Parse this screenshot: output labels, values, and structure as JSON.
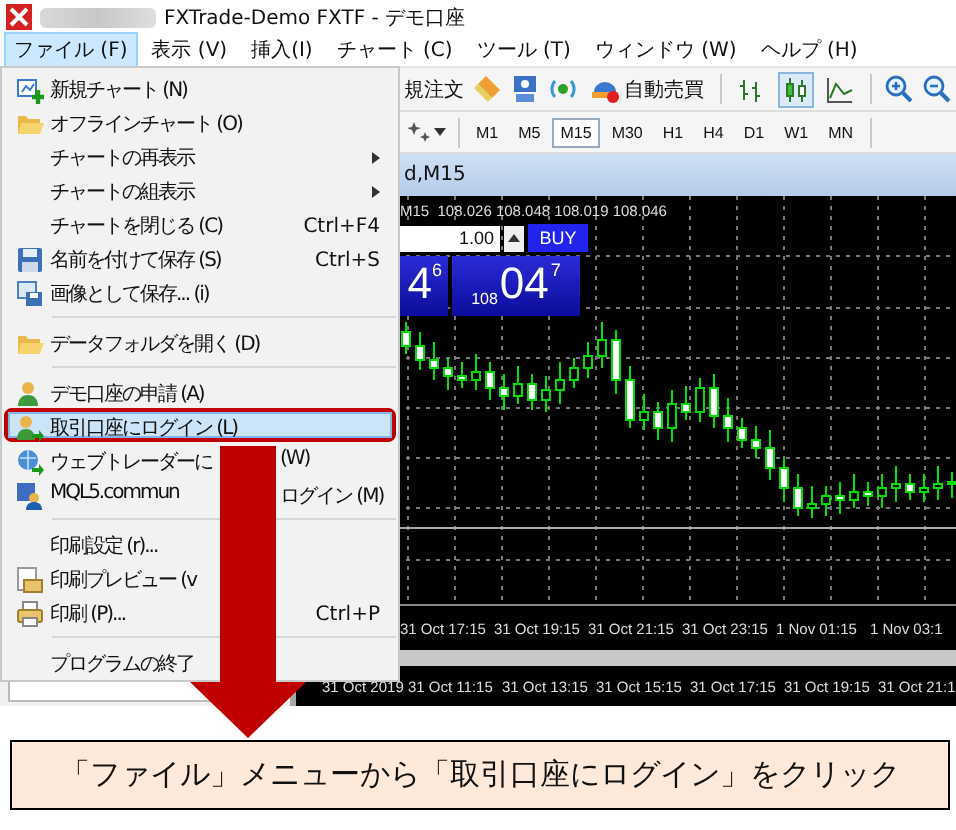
{
  "window": {
    "title": "FXTrade-Demo FXTF - デモ口座"
  },
  "menu_bar": [
    {
      "label": "ファイル (F)",
      "selected": true
    },
    {
      "label": "表示 (V)",
      "selected": false
    },
    {
      "label": "挿入(I)",
      "selected": false
    },
    {
      "label": "チャート (C)",
      "selected": false
    },
    {
      "label": "ツール (T)",
      "selected": false
    },
    {
      "label": "ウィンドウ (W)",
      "selected": false
    },
    {
      "label": "ヘルプ (H)",
      "selected": false
    }
  ],
  "toolbar": {
    "order_label": "規注文",
    "auto_trade": "自動売買",
    "chart_types": [
      {
        "kind": "bar",
        "selected": false
      },
      {
        "kind": "candle",
        "selected": true
      },
      {
        "kind": "line",
        "selected": false
      }
    ]
  },
  "timeframes": [
    {
      "label": "M1",
      "selected": false
    },
    {
      "label": "M5",
      "selected": false
    },
    {
      "label": "M15",
      "selected": true
    },
    {
      "label": "M30",
      "selected": false
    },
    {
      "label": "H1",
      "selected": false
    },
    {
      "label": "H4",
      "selected": false
    },
    {
      "label": "D1",
      "selected": false
    },
    {
      "label": "W1",
      "selected": false
    },
    {
      "label": "MN",
      "selected": false
    }
  ],
  "chart_window": {
    "title": "d,M15",
    "quote": "M15  108.026 108.048 108.019 108.046",
    "lot": "1.00",
    "buy_button": "BUY",
    "sell_price": {
      "main": "4",
      "pip": "6"
    },
    "buy_price": {
      "prefix": "108",
      "main": "04",
      "pip": "7"
    },
    "time_axis": [
      "31 Oct 17:15",
      "31 Oct 19:15",
      "31 Oct 21:15",
      "31 Oct 23:15",
      "1 Nov 01:15",
      "1 Nov 03:1"
    ],
    "lower_axis": [
      "31 Oct 2019",
      "31 Oct 11:15",
      "31 Oct 13:15",
      "31 Oct 15:15",
      "31 Oct 17:15",
      "31 Oct 19:15",
      "31 Oct 21:1"
    ]
  },
  "file_menu": [
    {
      "kind": "item",
      "label": "新規チャート (N)",
      "selected": false
    },
    {
      "kind": "item",
      "label": "オフラインチャート (O)",
      "selected": false
    },
    {
      "kind": "submenu",
      "label": "チャートの再表示",
      "selected": false
    },
    {
      "kind": "submenu",
      "label": "チャートの組表示",
      "selected": false
    },
    {
      "kind": "item",
      "label": "チャートを閉じる (C)",
      "shortcut": "Ctrl+F4",
      "selected": false
    },
    {
      "kind": "item",
      "label": "名前を付けて保存 (S)",
      "shortcut": "Ctrl+S",
      "selected": false
    },
    {
      "kind": "item",
      "label": "画像として保存... (i)",
      "selected": false
    },
    {
      "kind": "separator"
    },
    {
      "kind": "item",
      "label": "データフォルダを開く (D)",
      "selected": false
    },
    {
      "kind": "separator"
    },
    {
      "kind": "item",
      "label": "デモ口座の申請 (A)",
      "selected": false
    },
    {
      "kind": "item",
      "label": "取引口座にログイン (L)",
      "selected": true
    },
    {
      "kind": "item",
      "label": "ウェブトレーダーに",
      "tail": "(W)",
      "selected": false
    },
    {
      "kind": "item",
      "label": "MQL5.commun",
      "tail": "ログイン (M)",
      "selected": false
    },
    {
      "kind": "separator"
    },
    {
      "kind": "item",
      "label": "印刷設定 (r)...",
      "selected": false
    },
    {
      "kind": "item",
      "label": "印刷プレビュー (v",
      "selected": false
    },
    {
      "kind": "item",
      "label": "印刷 (P)...",
      "shortcut": "Ctrl+P",
      "selected": false
    },
    {
      "kind": "separator"
    },
    {
      "kind": "item",
      "label": "プログラムの終了",
      "selected": false
    }
  ],
  "caption": "「ファイル」メニューから「取引口座にログイン」をクリック"
}
